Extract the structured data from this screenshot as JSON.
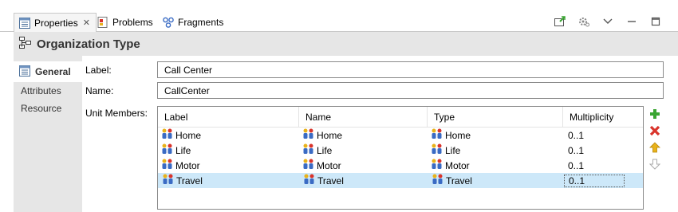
{
  "tabs": [
    {
      "label": "Properties",
      "close": "✕",
      "icon": "properties-icon"
    },
    {
      "label": "Problems",
      "icon": "problems-icon"
    },
    {
      "label": "Fragments",
      "icon": "fragments-icon"
    }
  ],
  "header": {
    "title": "Organization Type",
    "icon": "organization-type-icon"
  },
  "nav": [
    {
      "label": "General",
      "icon": "general-icon"
    },
    {
      "label": "Attributes"
    },
    {
      "label": "Resource"
    }
  ],
  "form": {
    "label_label": "Label:",
    "label_value": "Call Center",
    "name_label": "Name:",
    "name_value": "CallCenter",
    "members_label": "Unit Members:"
  },
  "table": {
    "columns": [
      "Label",
      "Name",
      "Type",
      "Multiplicity"
    ],
    "rows": [
      {
        "label": "Home",
        "name": "Home",
        "type": "Home",
        "multiplicity": "0..1"
      },
      {
        "label": "Life",
        "name": "Life",
        "type": "Life",
        "multiplicity": "0..1"
      },
      {
        "label": "Motor",
        "name": "Motor",
        "type": "Motor",
        "multiplicity": "0..1"
      },
      {
        "label": "Travel",
        "name": "Travel",
        "type": "Travel",
        "multiplicity": "0..1"
      }
    ]
  },
  "colors": {
    "header_bg": "#e6e6e6",
    "selection": "#cde8f9",
    "add": "#3aa532",
    "delete": "#d9342b",
    "move_up": "#e8b21a"
  }
}
